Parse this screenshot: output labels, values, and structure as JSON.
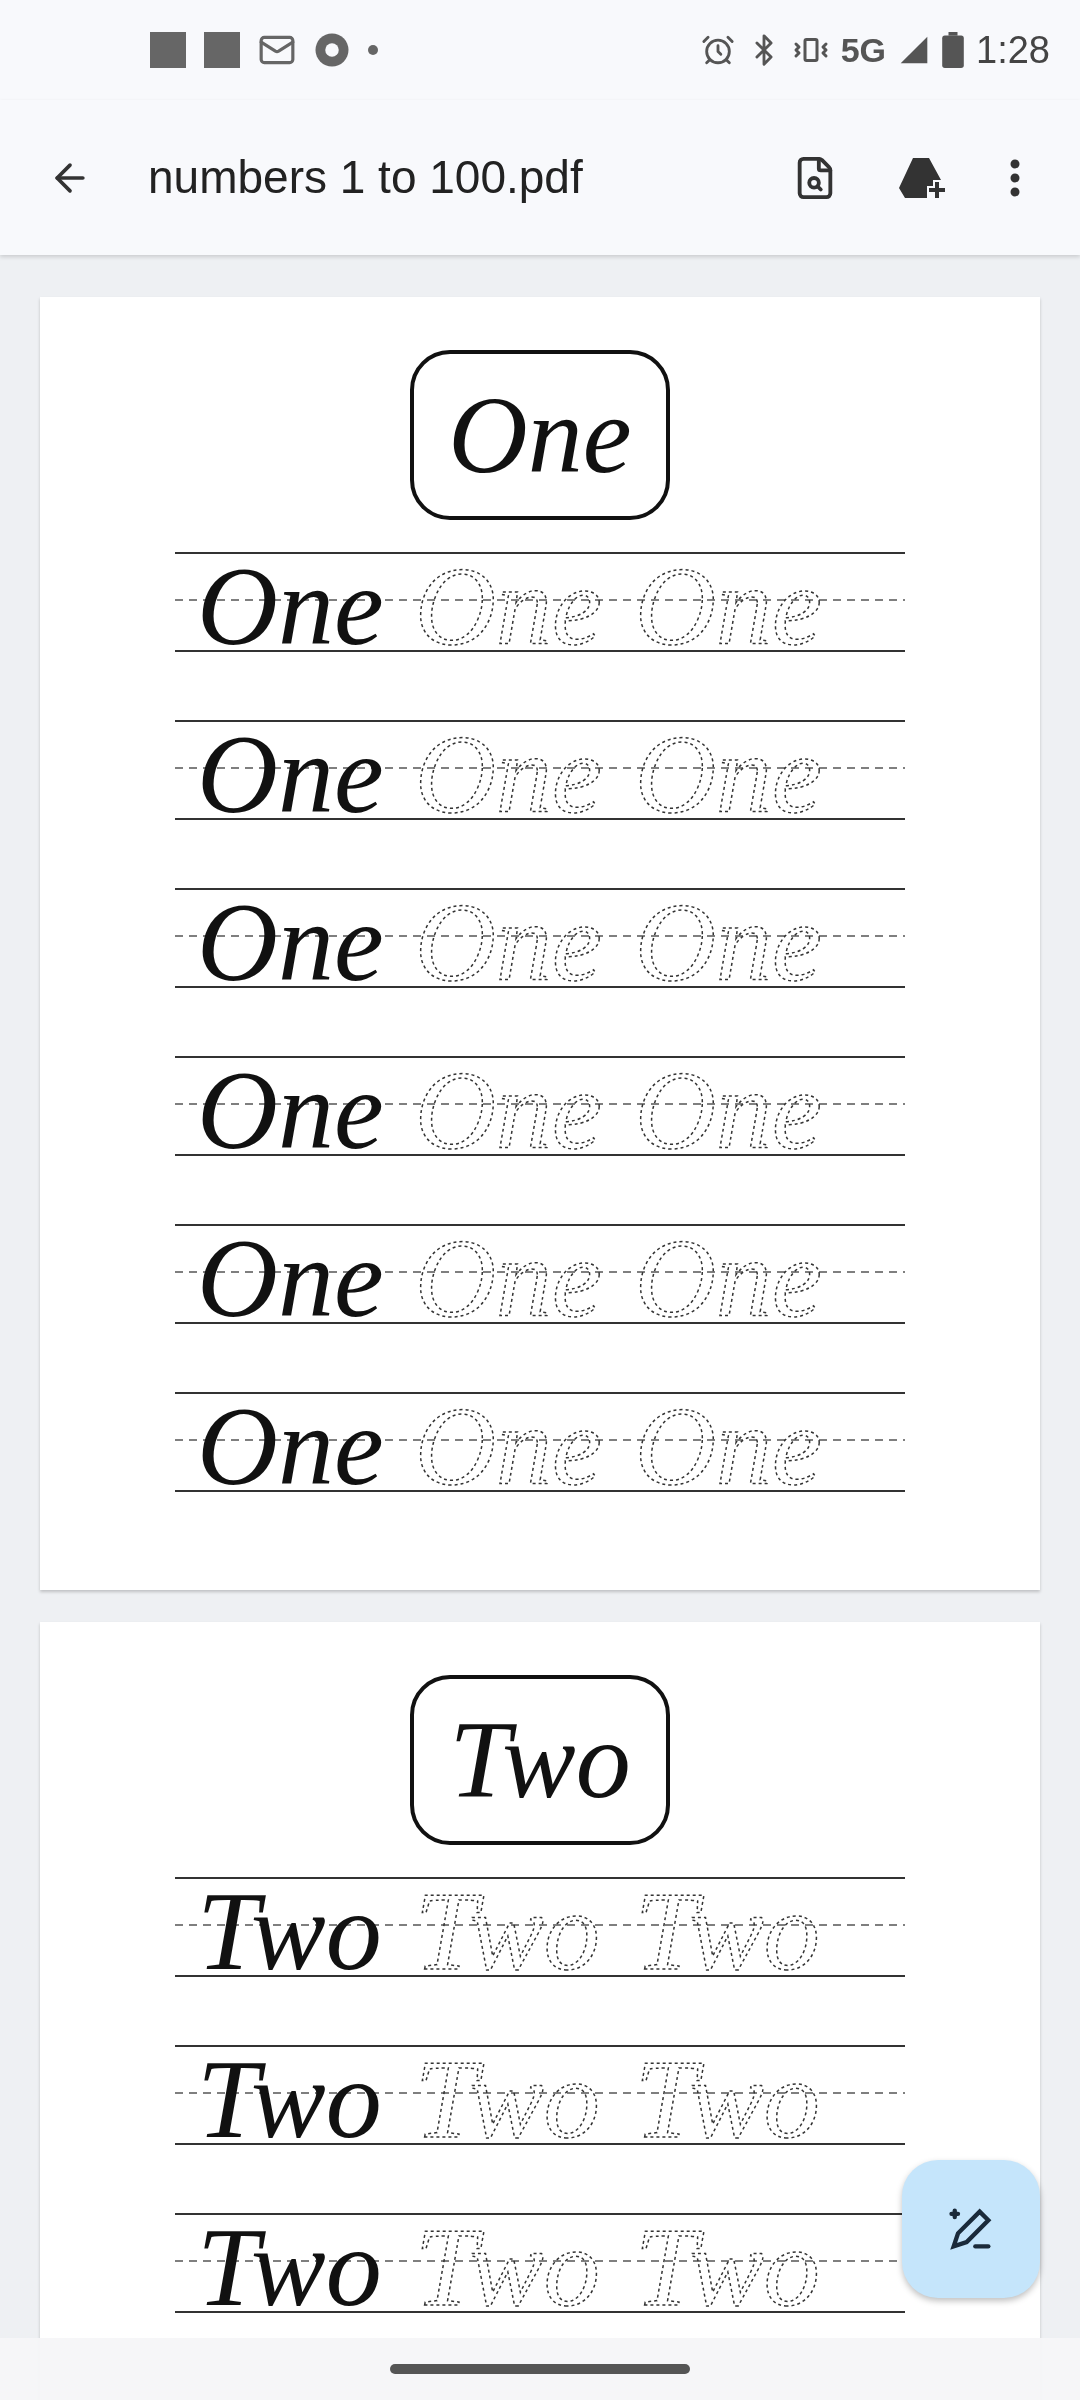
{
  "status_bar": {
    "network": "5G",
    "time": "1:28"
  },
  "app_bar": {
    "title": "numbers 1 to 100.pdf"
  },
  "pages": [
    {
      "heading": "One",
      "rows": [
        {
          "solid": "One",
          "traced": [
            "One",
            "One"
          ]
        },
        {
          "solid": "One",
          "traced": [
            "One",
            "One"
          ]
        },
        {
          "solid": "One",
          "traced": [
            "One",
            "One"
          ]
        },
        {
          "solid": "One",
          "traced": [
            "One",
            "One"
          ]
        },
        {
          "solid": "One",
          "traced": [
            "One",
            "One"
          ]
        },
        {
          "solid": "One",
          "traced": [
            "One",
            "One"
          ]
        }
      ]
    },
    {
      "heading": "Two",
      "rows": [
        {
          "solid": "Two",
          "traced": [
            "Two",
            "Two"
          ]
        },
        {
          "solid": "Two",
          "traced": [
            "Two",
            "Two"
          ]
        },
        {
          "solid": "Two",
          "traced": [
            "Two",
            "Two"
          ]
        }
      ]
    }
  ]
}
